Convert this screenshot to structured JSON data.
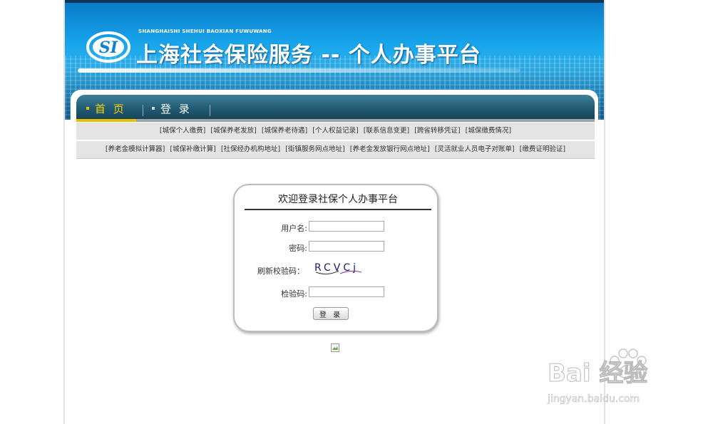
{
  "header": {
    "pinyin": "SHANGHAISHI SHEHUI BAOXIAN FUWUWANG",
    "title": "上海社会保险服务 -- 个人办事平台",
    "logo_text": "SI"
  },
  "nav": {
    "items": [
      {
        "label": "首 页",
        "active": true
      },
      {
        "label": "登 录",
        "active": false
      }
    ]
  },
  "links": {
    "row1": [
      "[城保个人缴费]",
      "[城保养老发放]",
      "[城保养老待遇]",
      "[个人权益记录]",
      "[联系信息变更]",
      "[跨省转移凭证]",
      "[城保缴费情况]"
    ],
    "row2": [
      "[养老金模拟计算器]",
      "[城保补缴计算]",
      "[社保经办机构地址]",
      "[街镇服务网点地址]",
      "[养老金发放银行网点地址]",
      "[灵活就业人员电子对账单]",
      "[缴费证明验证]"
    ]
  },
  "login": {
    "title": "欢迎登录社保个人办事平台",
    "username_label": "用户名:",
    "password_label": "密码:",
    "captcha_label": "刷新校验码：",
    "captcha_text": "RCVCj",
    "verify_label": "检验码:",
    "submit_label": "登 录",
    "username_value": "",
    "password_value": "",
    "verify_value": ""
  },
  "watermark": {
    "brand": "Bai 经验",
    "url": "jingyan.baidu.com"
  },
  "colors": {
    "banner_blue": "#16a3ea",
    "nav_teal": "#1f5870",
    "nav_active": "#ffd400",
    "link_row_bg": "#e4e4e4"
  }
}
